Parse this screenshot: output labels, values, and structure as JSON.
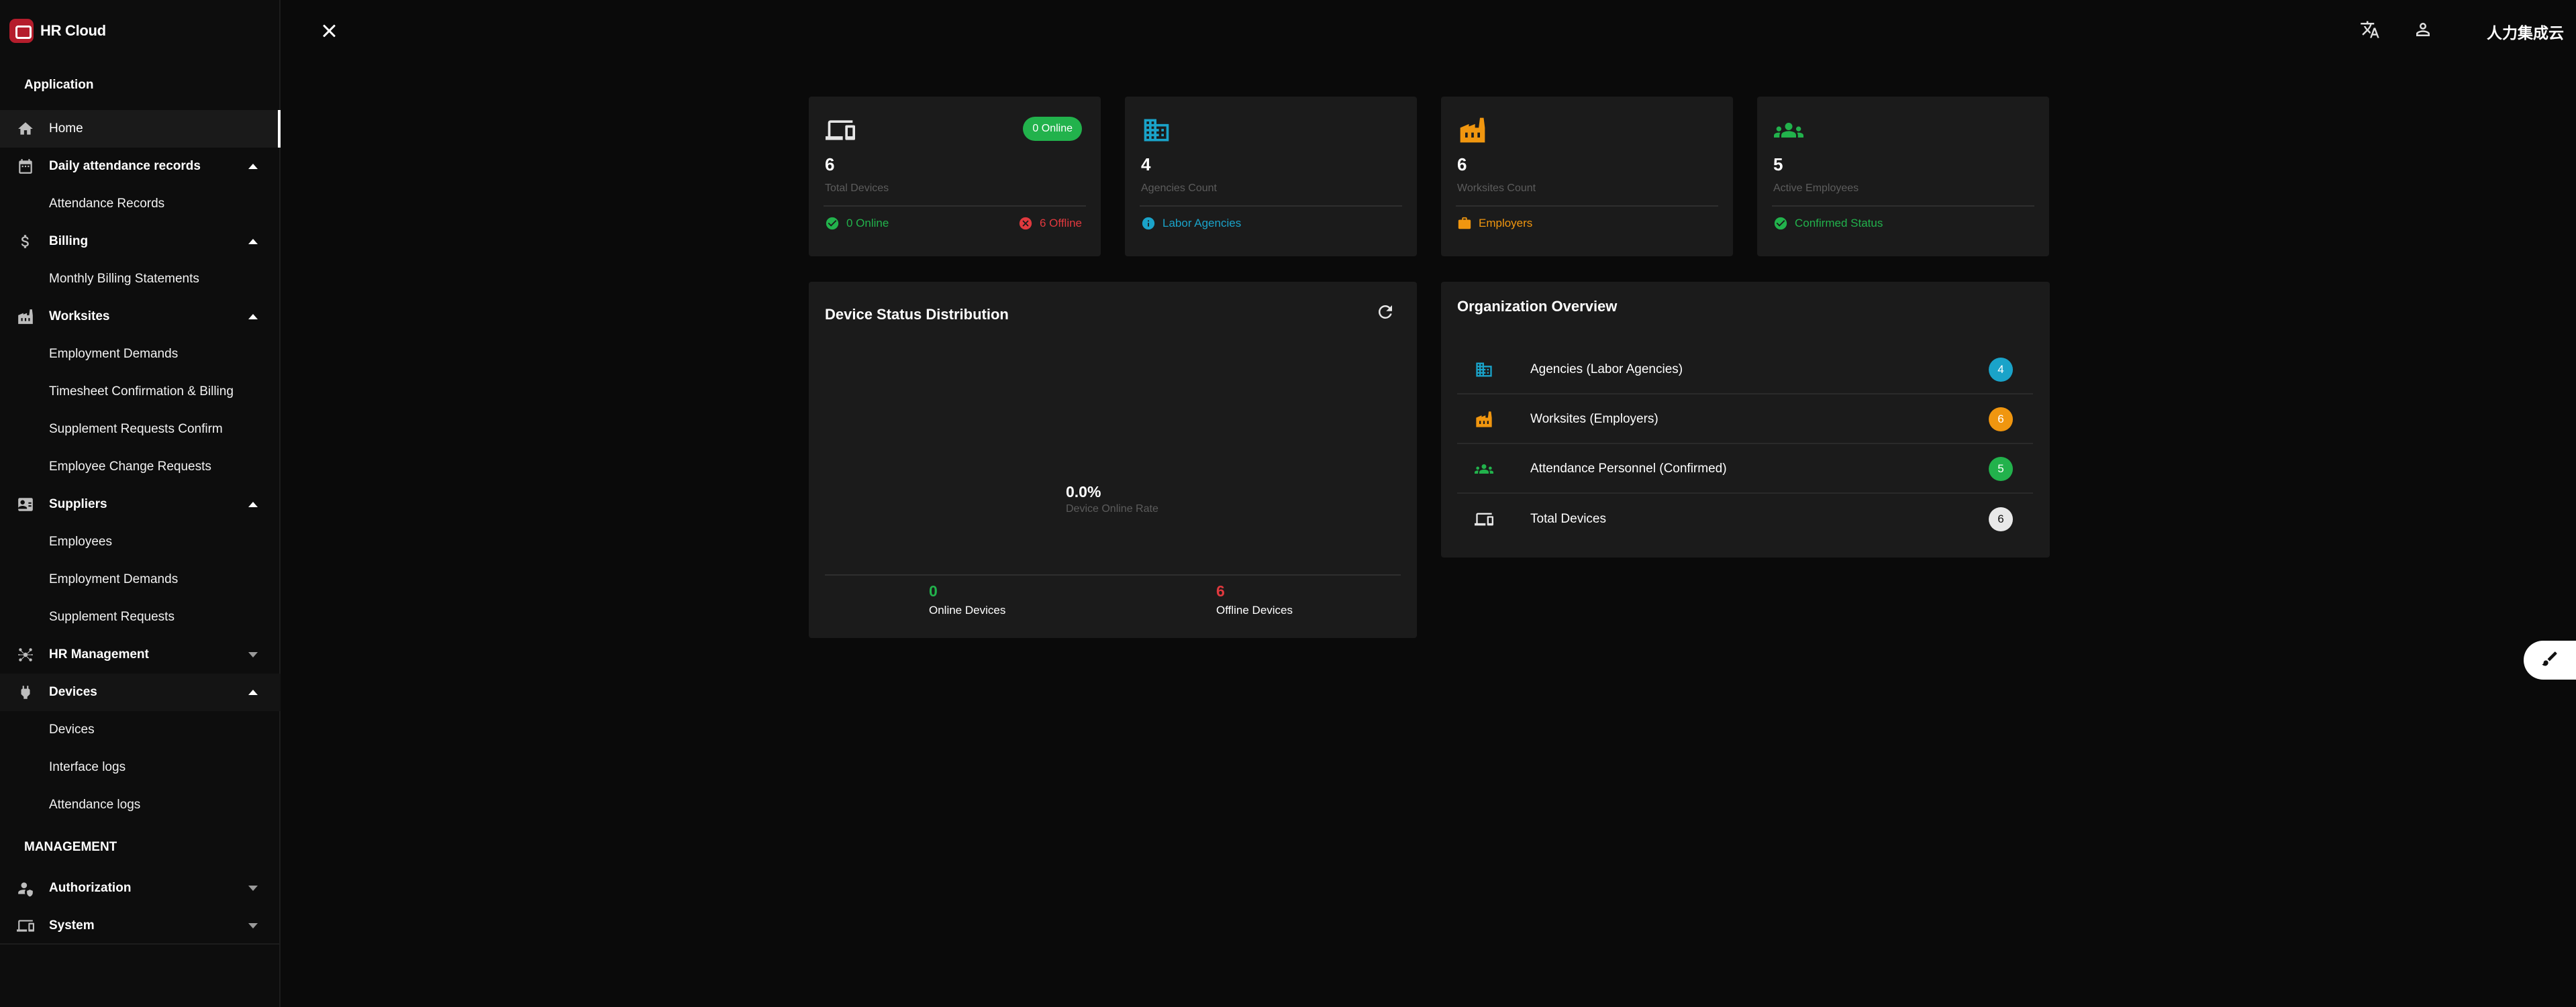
{
  "brand": {
    "name": "HR Cloud"
  },
  "sidebar": {
    "section_application": "Application",
    "section_management": "MANAGEMENT",
    "items": [
      {
        "label": "Home",
        "icon": "home-icon",
        "type": "link",
        "active": true
      },
      {
        "label": "Daily attendance records",
        "icon": "calendar-icon",
        "type": "group",
        "open": true
      },
      {
        "label": "Attendance Records",
        "type": "sub"
      },
      {
        "label": "Billing",
        "icon": "dollar-icon",
        "type": "group",
        "open": true
      },
      {
        "label": "Monthly Billing Statements",
        "type": "sub"
      },
      {
        "label": "Worksites",
        "icon": "factory-icon",
        "type": "group",
        "open": true
      },
      {
        "label": "Employment Demands",
        "type": "sub"
      },
      {
        "label": "Timesheet Confirmation & Billing",
        "type": "sub"
      },
      {
        "label": "Supplement Requests Confirm",
        "type": "sub"
      },
      {
        "label": "Employee Change Requests",
        "type": "sub"
      },
      {
        "label": "Suppliers",
        "icon": "contact-card-icon",
        "type": "group",
        "open": true
      },
      {
        "label": "Employees",
        "type": "sub"
      },
      {
        "label": "Employment Demands",
        "type": "sub"
      },
      {
        "label": "Supplement Requests",
        "type": "sub"
      },
      {
        "label": "HR Management",
        "icon": "hub-icon",
        "type": "group",
        "open": false
      },
      {
        "label": "Devices",
        "icon": "plug-icon",
        "type": "group",
        "open": true
      },
      {
        "label": "Devices",
        "type": "sub"
      },
      {
        "label": "Interface logs",
        "type": "sub"
      },
      {
        "label": "Attendance logs",
        "type": "sub"
      }
    ],
    "management_items": [
      {
        "label": "Authorization",
        "icon": "user-shield-icon"
      },
      {
        "label": "System",
        "icon": "devices-icon"
      }
    ]
  },
  "topbar": {
    "user_label": "人力集成云"
  },
  "stats": {
    "devices": {
      "value": "6",
      "caption": "Total Devices",
      "pill": "0 Online",
      "online_text": "0 Online",
      "offline_text": "6 Offline"
    },
    "agencies": {
      "value": "4",
      "caption": "Agencies Count",
      "foot_text": "Labor Agencies"
    },
    "worksites": {
      "value": "6",
      "caption": "Worksites Count",
      "foot_text": "Employers"
    },
    "employees": {
      "value": "5",
      "caption": "Active Employees",
      "foot_text": "Confirmed Status"
    }
  },
  "device_chart": {
    "title": "Device Status Distribution",
    "center_value": "0.0%",
    "center_label": "Device Online Rate",
    "online_value": "0",
    "online_label": "Online Devices",
    "offline_value": "6",
    "offline_label": "Offline Devices"
  },
  "org_overview": {
    "title": "Organization Overview",
    "rows": [
      {
        "label": "Agencies (Labor Agencies)",
        "count": "4",
        "color": "#1aa3c9",
        "icon": "building-icon"
      },
      {
        "label": "Worksites (Employers)",
        "count": "6",
        "color": "#f0960f",
        "icon": "factory-icon"
      },
      {
        "label": "Attendance Personnel (Confirmed)",
        "count": "5",
        "color": "#22b24c",
        "icon": "people-icon"
      },
      {
        "label": "Total Devices",
        "count": "6",
        "color": "#e8e8e8",
        "icon": "devices-icon"
      }
    ]
  },
  "colors": {
    "green": "#22b24c",
    "red": "#e0393e",
    "cyan": "#1aa3c9",
    "orange": "#f0960f"
  }
}
